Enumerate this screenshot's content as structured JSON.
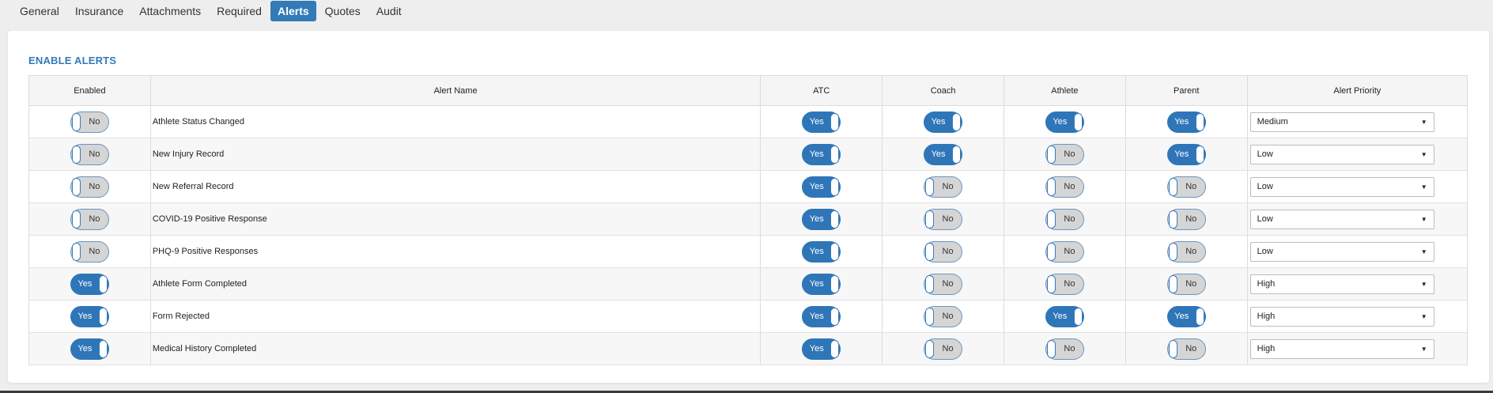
{
  "tabs": [
    {
      "label": "General",
      "active": false
    },
    {
      "label": "Insurance",
      "active": false
    },
    {
      "label": "Attachments",
      "active": false
    },
    {
      "label": "Required",
      "active": false
    },
    {
      "label": "Alerts",
      "active": true
    },
    {
      "label": "Quotes",
      "active": false
    },
    {
      "label": "Audit",
      "active": false
    }
  ],
  "section_title": "ENABLE ALERTS",
  "columns": {
    "enabled": "Enabled",
    "alert_name": "Alert Name",
    "atc": "ATC",
    "coach": "Coach",
    "athlete": "Athlete",
    "parent": "Parent",
    "priority": "Alert Priority"
  },
  "toggle_labels": {
    "on": "Yes",
    "off": "No"
  },
  "rows": [
    {
      "enabled": false,
      "name": "Athlete Status Changed",
      "atc": true,
      "coach": true,
      "athlete": true,
      "parent": true,
      "priority": "Medium"
    },
    {
      "enabled": false,
      "name": "New Injury Record",
      "atc": true,
      "coach": true,
      "athlete": false,
      "parent": true,
      "priority": "Low"
    },
    {
      "enabled": false,
      "name": "New Referral Record",
      "atc": true,
      "coach": false,
      "athlete": false,
      "parent": false,
      "priority": "Low"
    },
    {
      "enabled": false,
      "name": "COVID-19 Positive Response",
      "atc": true,
      "coach": false,
      "athlete": false,
      "parent": false,
      "priority": "Low"
    },
    {
      "enabled": false,
      "name": "PHQ-9 Positive Responses",
      "atc": true,
      "coach": false,
      "athlete": false,
      "parent": false,
      "priority": "Low"
    },
    {
      "enabled": true,
      "name": "Athlete Form Completed",
      "atc": true,
      "coach": false,
      "athlete": false,
      "parent": false,
      "priority": "High"
    },
    {
      "enabled": true,
      "name": "Form Rejected",
      "atc": true,
      "coach": false,
      "athlete": true,
      "parent": true,
      "priority": "High"
    },
    {
      "enabled": true,
      "name": "Medical History Completed",
      "atc": true,
      "coach": false,
      "athlete": false,
      "parent": false,
      "priority": "High"
    }
  ],
  "colors": {
    "accent": "#337ab7",
    "toggle_on": "#2f76b8",
    "toggle_off": "#d5d5d5"
  },
  "icons": {
    "select_caret": "caret-down-icon"
  }
}
